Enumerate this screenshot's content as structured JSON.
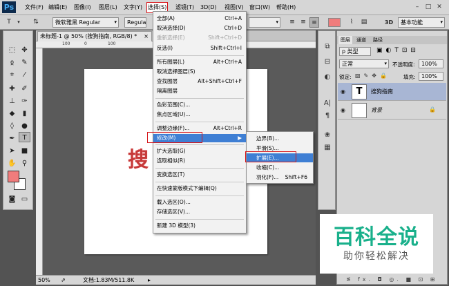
{
  "app": {
    "logo": "Ps"
  },
  "menubar": {
    "items": [
      "文件(F)",
      "编辑(E)",
      "图像(I)",
      "图层(L)",
      "文字(Y)",
      "选择(S)",
      "滤镜(T)",
      "3D(D)",
      "视图(V)",
      "窗口(W)",
      "帮助(H)"
    ],
    "window_controls": [
      "–",
      "□",
      "✕"
    ]
  },
  "options": {
    "font_family": "微软雅黑 Regular",
    "font_style": "Regular",
    "color": "#f07c7c",
    "workspace": "基本功能"
  },
  "document": {
    "tab_title": "未标题-1 @ 50% (搜狗指南, RGB/8) *",
    "ruler_ticks": [
      "100",
      "0",
      "100"
    ],
    "canvas_text": "搜",
    "zoom": "50%",
    "doc_info": "文档:1.83M/511.8K"
  },
  "select_menu": {
    "items": [
      {
        "label": "全部(A)",
        "shortcut": "Ctrl+A"
      },
      {
        "label": "取消选择(D)",
        "shortcut": "Ctrl+D"
      },
      {
        "label": "重新选择(E)",
        "shortcut": "Shift+Ctrl+D"
      },
      {
        "label": "反选(I)",
        "shortcut": "Shift+Ctrl+I"
      },
      {
        "label": "所有图层(L)",
        "shortcut": "Alt+Ctrl+A"
      },
      {
        "label": "取消选择图层(S)",
        "shortcut": ""
      },
      {
        "label": "查找图层",
        "shortcut": "Alt+Shift+Ctrl+F"
      },
      {
        "label": "隔离图层",
        "shortcut": ""
      },
      {
        "label": "色彩范围(C)...",
        "shortcut": ""
      },
      {
        "label": "焦点区域(U)...",
        "shortcut": ""
      },
      {
        "label": "调整边缘(F)...",
        "shortcut": "Alt+Ctrl+R"
      },
      {
        "label": "修改(M)",
        "shortcut": "▶"
      },
      {
        "label": "扩大选取(G)",
        "shortcut": ""
      },
      {
        "label": "选取相似(R)",
        "shortcut": ""
      },
      {
        "label": "变换选区(T)",
        "shortcut": ""
      },
      {
        "label": "在快速蒙版模式下编辑(Q)",
        "shortcut": ""
      },
      {
        "label": "载入选区(O)...",
        "shortcut": ""
      },
      {
        "label": "存储选区(V)...",
        "shortcut": ""
      },
      {
        "label": "新建 3D 模型(3)",
        "shortcut": ""
      }
    ]
  },
  "modify_submenu": {
    "items": [
      {
        "label": "边界(B)...",
        "shortcut": ""
      },
      {
        "label": "平滑(S)...",
        "shortcut": ""
      },
      {
        "label": "扩展(E)...",
        "shortcut": ""
      },
      {
        "label": "收缩(C)...",
        "shortcut": ""
      },
      {
        "label": "羽化(F)...",
        "shortcut": "Shift+F6"
      }
    ]
  },
  "layers_panel": {
    "tabs": [
      "图层",
      "通道",
      "路径"
    ],
    "kind_filter": "p 类型",
    "blend_mode": "正常",
    "opacity_label": "不透明度:",
    "opacity": "100%",
    "lock_label": "锁定:",
    "fill_label": "填充:",
    "fill": "100%",
    "layers": [
      {
        "name": "搜狗指南",
        "thumb": "T"
      },
      {
        "name": "背景",
        "thumb": ""
      }
    ],
    "footer_icons": "ᓬ fx. ◘ ◎. ■ ⊡ ⊞"
  },
  "watermark": {
    "title": "百科全说",
    "subtitle": "助你轻松解决"
  }
}
